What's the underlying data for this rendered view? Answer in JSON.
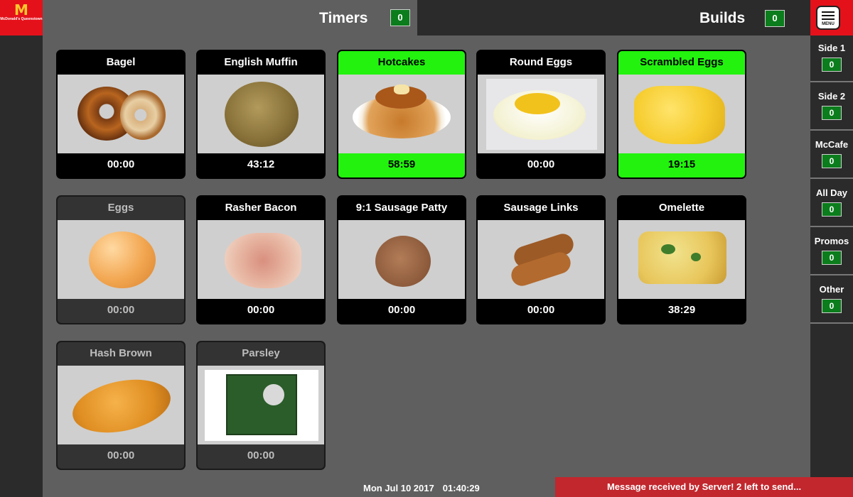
{
  "brand": {
    "logo_text": "McDonald's Queenstown"
  },
  "header": {
    "timers": {
      "label": "Timers",
      "count": "0"
    },
    "builds": {
      "label": "Builds",
      "count": "0"
    },
    "menu_label": "MENU"
  },
  "categories": [
    {
      "label": "Side 1",
      "count": "0"
    },
    {
      "label": "Side 2",
      "count": "0"
    },
    {
      "label": "McCafe",
      "count": "0"
    },
    {
      "label": "All Day",
      "count": "0"
    },
    {
      "label": "Promos",
      "count": "0"
    },
    {
      "label": "Other",
      "count": "0"
    }
  ],
  "tiles": [
    {
      "name": "Bagel",
      "time": "00:00",
      "state": "idle",
      "icon": "bagel"
    },
    {
      "name": "English Muffin",
      "time": "43:12",
      "state": "idle",
      "icon": "english-muffin"
    },
    {
      "name": "Hotcakes",
      "time": "58:59",
      "state": "active",
      "icon": "hotcakes"
    },
    {
      "name": "Round Eggs",
      "time": "00:00",
      "state": "idle",
      "icon": "round-egg"
    },
    {
      "name": "Scrambled Eggs",
      "time": "19:15",
      "state": "active",
      "icon": "scrambled-eggs"
    },
    {
      "name": "Eggs",
      "time": "00:00",
      "state": "disabled",
      "icon": "egg"
    },
    {
      "name": "Rasher Bacon",
      "time": "00:00",
      "state": "idle",
      "icon": "bacon"
    },
    {
      "name": "9:1 Sausage Patty",
      "time": "00:00",
      "state": "idle",
      "icon": "sausage-patty"
    },
    {
      "name": "Sausage Links",
      "time": "00:00",
      "state": "idle",
      "icon": "sausage-links"
    },
    {
      "name": "Omelette",
      "time": "38:29",
      "state": "idle",
      "icon": "omelette"
    },
    {
      "name": "Hash Brown",
      "time": "00:00",
      "state": "disabled",
      "icon": "hash-brown"
    },
    {
      "name": "Parsley",
      "time": "00:00",
      "state": "disabled",
      "icon": "parsley"
    }
  ],
  "footer": {
    "date": "Mon Jul 10 2017",
    "time": "01:40:29",
    "message": "Message received by Server! 2 left to send..."
  },
  "colors": {
    "brand_red": "#e4111b",
    "active_green": "#22f20e",
    "badge_green": "#0b7d1c",
    "message_red": "#c1272d"
  }
}
